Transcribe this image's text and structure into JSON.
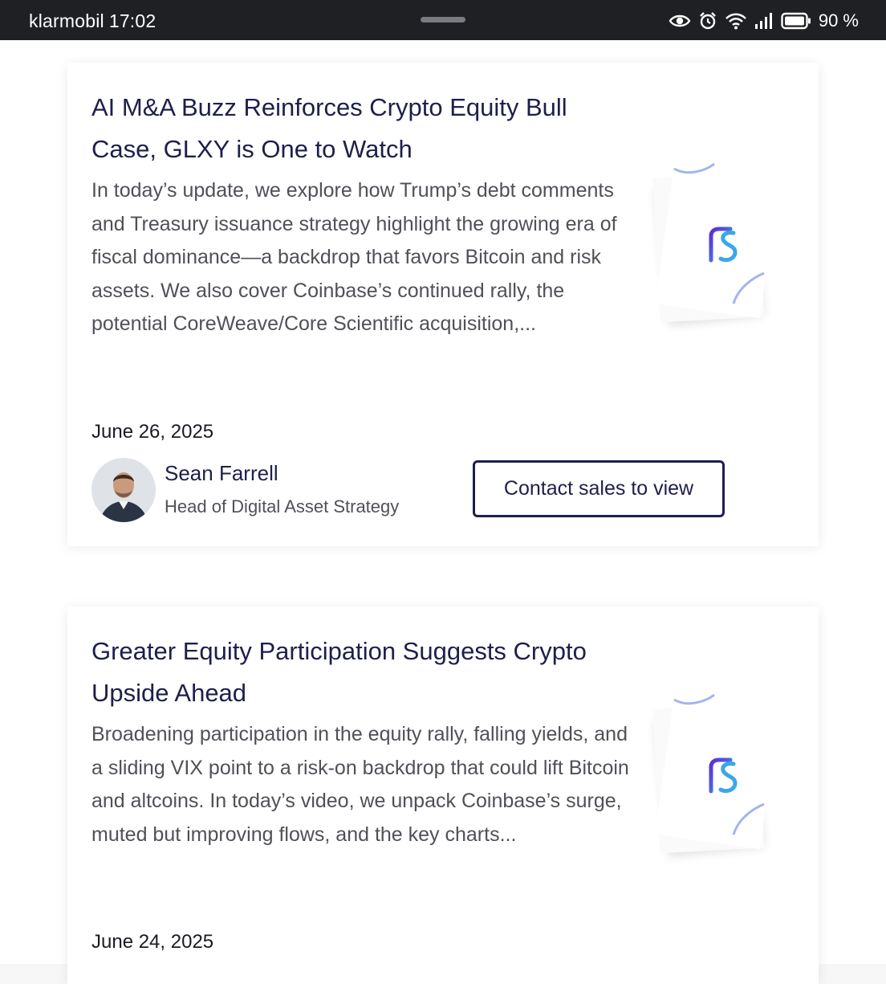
{
  "status_bar": {
    "carrier": "klarmobil",
    "time": "17:02",
    "battery": "90 %",
    "icons": [
      "eye-icon",
      "alarm-icon",
      "wifi-icon",
      "signal-icon",
      "battery-icon"
    ]
  },
  "articles": [
    {
      "title": "AI M&A Buzz Reinforces Crypto Equity Bull Case, GLXY is One to Watch",
      "excerpt": "In today’s update, we explore how Trump’s debt comments and Treasury issuance strategy highlight the growing era of fiscal dominance—a backdrop that favors Bitcoin and risk assets. We also cover Coinbase’s continued rally, the potential CoreWeave/Core Scientific acquisition,...",
      "date": "June 26, 2025",
      "author": {
        "name": "Sean Farrell",
        "role": "Head of Digital Asset Strategy"
      },
      "cta_label": "Contact sales to view"
    },
    {
      "title": "Greater Equity Participation Suggests Crypto Upside Ahead",
      "excerpt": "Broadening participation in the equity rally, falling yields, and a sliding VIX point to a risk-on backdrop that could lift Bitcoin and altcoins. In today’s video, we unpack Coinbase’s surge, muted but improving flows, and the key charts...",
      "date": "June 24, 2025"
    }
  ],
  "colors": {
    "title": "#1e1f4b",
    "body_text": "#505058",
    "status_bar_bg": "#1f2023",
    "logo_purple": "#5b2bd6",
    "logo_blue": "#3ba7e8"
  }
}
